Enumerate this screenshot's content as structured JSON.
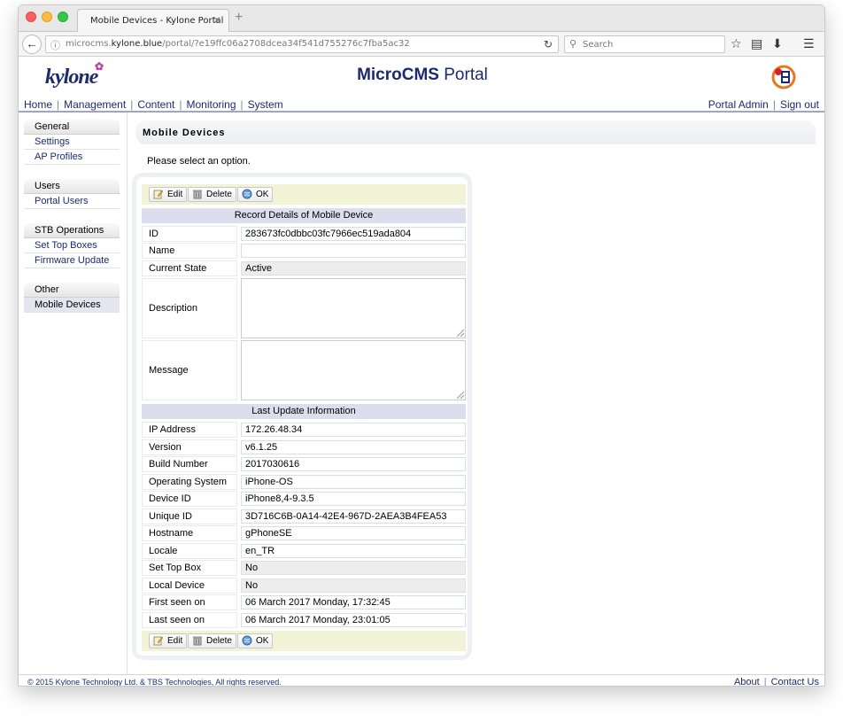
{
  "browser": {
    "tab_title": "Mobile Devices - Kylone Portal",
    "tab_close": "✕",
    "new_tab": "+",
    "url_prefix": "microcms.",
    "url_domain": "kylone.blue",
    "url_path": "/portal/?e19ffc06a2708dcea34f541d755276c7fba5ac32",
    "search_placeholder": "Search"
  },
  "header": {
    "logo_text": "kylone",
    "title_bold": "MicroCMS",
    "title_rest": " Portal"
  },
  "menu": {
    "left": [
      "Home",
      "Management",
      "Content",
      "Monitoring",
      "System"
    ],
    "right": [
      "Portal Admin",
      "Sign out"
    ]
  },
  "sidebar": [
    {
      "title": "General",
      "items": [
        "Settings",
        "AP Profiles"
      ]
    },
    {
      "title": "Users",
      "items": [
        "Portal Users"
      ]
    },
    {
      "title": "STB Operations",
      "items": [
        "Set Top Boxes",
        "Firmware Update"
      ]
    },
    {
      "title": "Other",
      "items": [
        "Mobile Devices"
      ]
    }
  ],
  "content": {
    "title": "Mobile Devices",
    "select_msg": "Please select an option."
  },
  "toolbar": {
    "edit": "Edit",
    "delete": "Delete",
    "ok": "OK"
  },
  "record": {
    "section_title": "Record Details of Mobile Device",
    "id_label": "ID",
    "id_value": "283673fc0dbbc03fc7966ec519ada804",
    "name_label": "Name",
    "name_value": "",
    "state_label": "Current State",
    "state_value": "Active",
    "description_label": "Description",
    "description_value": "",
    "message_label": "Message",
    "message_value": ""
  },
  "update": {
    "section_title": "Last Update Information",
    "rows": [
      {
        "label": "IP Address",
        "value": "172.26.48.34",
        "readonly": false
      },
      {
        "label": "Version",
        "value": "v6.1.25",
        "readonly": false
      },
      {
        "label": "Build Number",
        "value": "2017030616",
        "readonly": false
      },
      {
        "label": "Operating System",
        "value": "iPhone-OS",
        "readonly": false
      },
      {
        "label": "Device ID",
        "value": "iPhone8,4-9.3.5",
        "readonly": false
      },
      {
        "label": "Unique ID",
        "value": "3D716C6B-0A14-42E4-967D-2AEA3B4FEA53",
        "readonly": false
      },
      {
        "label": "Hostname",
        "value": "gPhoneSE",
        "readonly": false
      },
      {
        "label": "Locale",
        "value": "en_TR",
        "readonly": false
      },
      {
        "label": "Set Top Box",
        "value": "No",
        "readonly": true
      },
      {
        "label": "Local Device",
        "value": "No",
        "readonly": true
      },
      {
        "label": "First seen on",
        "value": "06 March 2017 Monday, 17:32:45",
        "readonly": false
      },
      {
        "label": "Last seen on",
        "value": "06 March 2017 Monday, 23:01:05",
        "readonly": false
      }
    ]
  },
  "footer": {
    "copyright": "© 2015 Kylone Technology Ltd. & TBS Technologies, All rights reserved.",
    "about": "About",
    "contact": "Contact Us"
  }
}
